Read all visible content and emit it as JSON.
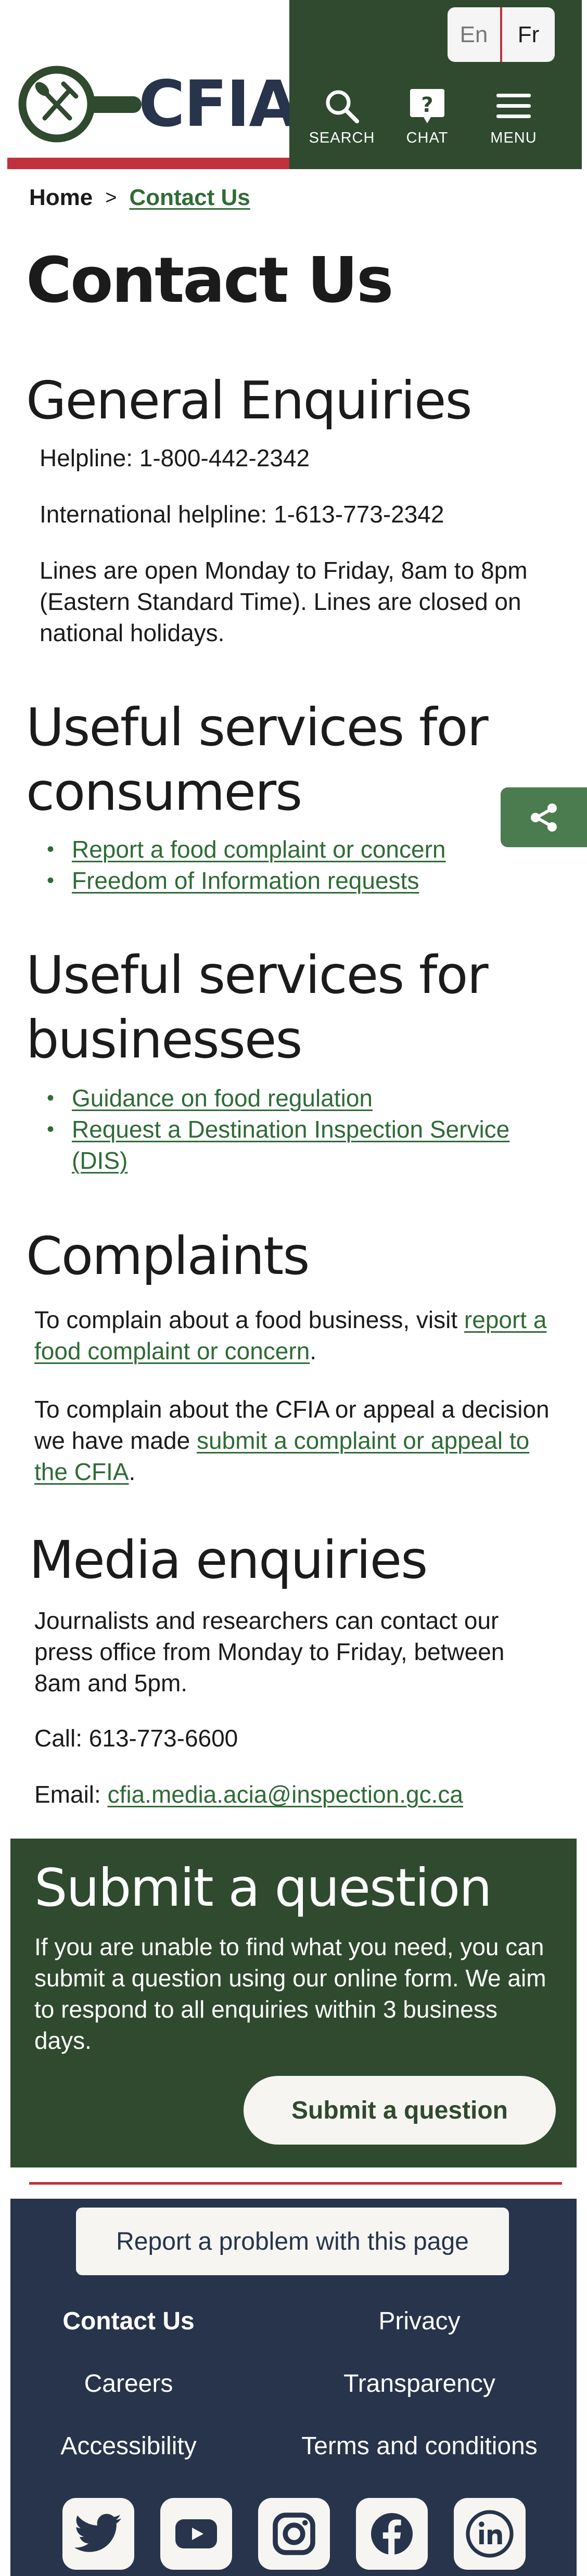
{
  "header": {
    "logo_text": "CFIA",
    "lang": {
      "en": "En",
      "fr": "Fr"
    },
    "nav": {
      "search": "SEARCH",
      "chat": "CHAT",
      "menu": "MENU"
    },
    "colors": {
      "green": "#2f4a2e",
      "red": "#c0323d",
      "navy": "#27344b"
    }
  },
  "breadcrumb": {
    "home": "Home",
    "separator": ">",
    "current": "Contact Us"
  },
  "page_title": "Contact Us",
  "general": {
    "heading": "General Enquiries",
    "helpline": "Helpline: 1-800-442-2342",
    "intl": "International helpline: 1-613-773-2342",
    "hours": "Lines are open Monday to Friday, 8am to 8pm (Eastern Standard Time). Lines are closed on national holidays."
  },
  "consumers": {
    "heading": "Useful services for consumers",
    "links": [
      "Report a food complaint or concern",
      "Freedom of Information requests"
    ]
  },
  "businesses": {
    "heading": "Useful services for businesses",
    "links": [
      "Guidance on food regulation",
      "Request a Destination Inspection Service (DIS)"
    ]
  },
  "complaints": {
    "heading": "Complaints",
    "p1_text": "To complain about a food business, visit ",
    "p1_link": "report a food complaint or concern",
    "p1_end": ".",
    "p2_text": "To complain about the CFIA or appeal a decision we have made ",
    "p2_link": "submit a complaint or appeal to the CFIA",
    "p2_end": "."
  },
  "media": {
    "heading": "Media enquiries",
    "text": "Journalists and researchers can contact our press office from Monday to Friday, between 8am and 5pm.",
    "call": "Call: 613-773-6600",
    "email_label": "Email: ",
    "email": "cfia.media.acia@inspection.gc.ca"
  },
  "submit_question": {
    "heading": "Submit a question",
    "text": "If you are unable to find what you need, you can submit a question using our online form. We aim to respond to all enquiries within 3 business days.",
    "button": "Submit a question"
  },
  "footer": {
    "report_button": "Report a problem with this page",
    "links": [
      "Contact Us",
      "Privacy",
      "Careers",
      "Transparency",
      "Accessibility",
      "Terms and conditions"
    ],
    "social": [
      "twitter-icon",
      "youtube-icon",
      "instagram-icon",
      "facebook-icon",
      "linkedin-icon"
    ]
  }
}
